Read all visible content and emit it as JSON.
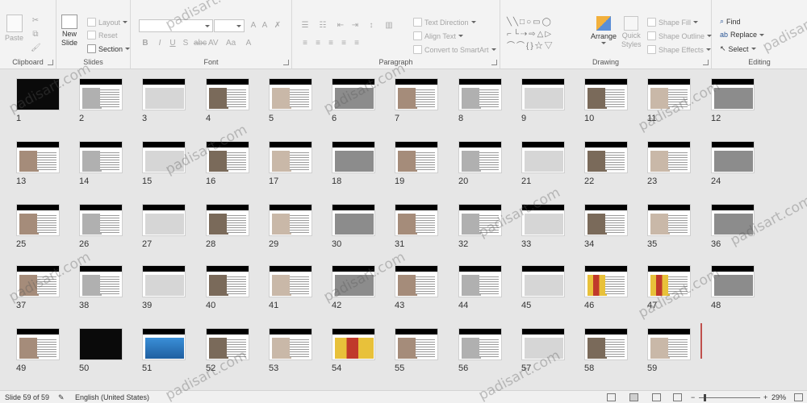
{
  "ribbon": {
    "clipboard": {
      "label": "Clipboard",
      "paste": "Paste"
    },
    "slides": {
      "label": "Slides",
      "new_slide_1": "New",
      "new_slide_2": "Slide",
      "layout": "Layout",
      "reset": "Reset",
      "section": "Section"
    },
    "font": {
      "label": "Font"
    },
    "paragraph": {
      "label": "Paragraph",
      "text_direction": "Text Direction",
      "align_text": "Align Text",
      "convert_smartart": "Convert to SmartArt"
    },
    "drawing": {
      "label": "Drawing",
      "arrange": "Arrange",
      "quick_styles_1": "Quick",
      "quick_styles_2": "Styles",
      "shape_fill": "Shape Fill",
      "shape_outline": "Shape Outline",
      "shape_effects": "Shape Effects"
    },
    "editing": {
      "label": "Editing",
      "find": "Find",
      "replace": "Replace",
      "select": "Select"
    }
  },
  "slides": [
    "1",
    "2",
    "3",
    "4",
    "5",
    "6",
    "7",
    "8",
    "9",
    "10",
    "11",
    "12",
    "13",
    "14",
    "15",
    "16",
    "17",
    "18",
    "19",
    "20",
    "21",
    "22",
    "23",
    "24",
    "25",
    "26",
    "27",
    "28",
    "29",
    "30",
    "31",
    "32",
    "33",
    "34",
    "35",
    "36",
    "37",
    "38",
    "39",
    "40",
    "41",
    "42",
    "43",
    "44",
    "45",
    "46",
    "47",
    "48",
    "49",
    "50",
    "51",
    "52",
    "53",
    "54",
    "55",
    "56",
    "57",
    "58",
    "59"
  ],
  "status": {
    "slide_info": "Slide 59 of 59",
    "language": "English (United States)",
    "zoom": "29%"
  },
  "watermark": "padisart.com",
  "colors": {
    "accent": "#c0504d",
    "ribbon_bg": "#f3f3f3",
    "sorter_bg": "#e6e6e6"
  }
}
